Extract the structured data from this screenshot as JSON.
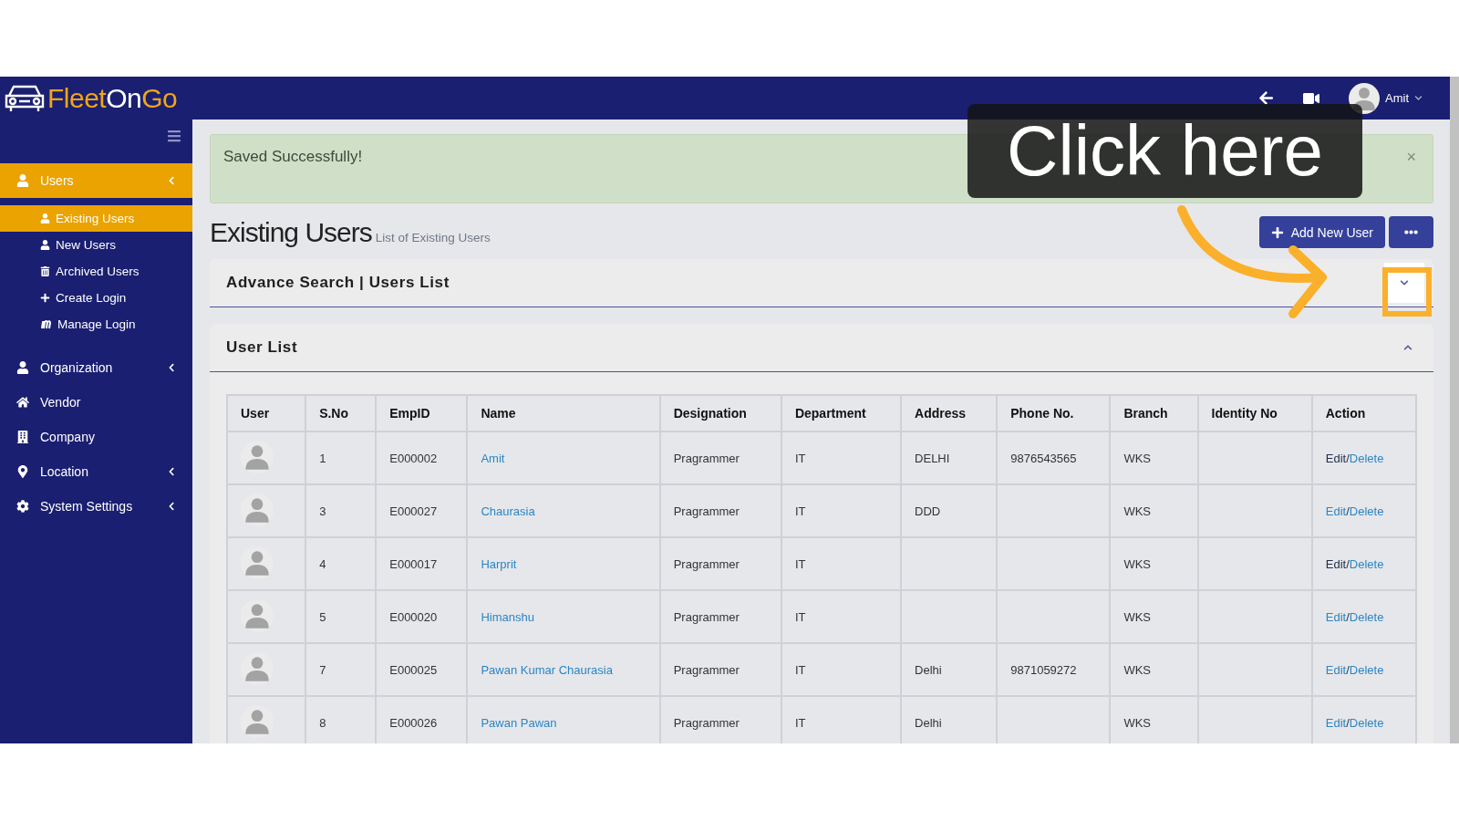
{
  "header": {
    "logo": [
      {
        "text": "Fleet",
        "color": "#f2a516"
      },
      {
        "text": "On",
        "color": "#ffffff"
      },
      {
        "text": "Go",
        "color": "#f2a516"
      }
    ],
    "user": "Amit"
  },
  "sidebar": {
    "items": [
      {
        "label": "Users",
        "kind": "group",
        "selected": true,
        "children": [
          {
            "label": "Existing Users",
            "selected": true
          },
          {
            "label": "New Users",
            "selected": false
          },
          {
            "label": "Archived Users",
            "selected": false
          },
          {
            "label": "Create Login",
            "selected": false
          },
          {
            "label": "Manage Login",
            "selected": false
          }
        ]
      },
      {
        "label": "Organization",
        "kind": "group",
        "selected": false
      },
      {
        "label": "Vendor",
        "kind": "link",
        "selected": false
      },
      {
        "label": "Company",
        "kind": "link",
        "selected": false
      },
      {
        "label": "Location",
        "kind": "group",
        "selected": false
      },
      {
        "label": "System Settings",
        "kind": "group",
        "selected": false
      }
    ]
  },
  "alert": {
    "message": "Saved Successfully!",
    "close": "×"
  },
  "page": {
    "title": "Existing Users",
    "subtitle": "List of Existing Users",
    "add_button": "Add New User"
  },
  "search_panel": {
    "title": "Advance Search | Users List",
    "expanded": false
  },
  "list_panel": {
    "title": "User List",
    "expanded": true
  },
  "table": {
    "columns": [
      "User",
      "S.No",
      "EmpID",
      "Name",
      "Designation",
      "Department",
      "Address",
      "Phone No.",
      "Branch",
      "Identity No",
      "Action"
    ],
    "rows": [
      {
        "sno": "1",
        "emp_id": "E000002",
        "name": "Amit",
        "designation": "Pragrammer",
        "department": "IT",
        "address": "DELHI",
        "phone": "9876543565",
        "branch": "WKS",
        "edit": "Edit",
        "edit_visited": true,
        "separator": "/",
        "delete": "Delete"
      },
      {
        "sno": "3",
        "emp_id": "E000027",
        "name": "Chaurasia",
        "designation": "Pragrammer",
        "department": "IT",
        "address": "DDD",
        "branch": "WKS",
        "edit": "Edit",
        "edit_visited": false,
        "separator": "/",
        "delete": "Delete"
      },
      {
        "sno": "4",
        "emp_id": "E000017",
        "name": "Harprit",
        "designation": "Pragrammer",
        "department": "IT",
        "branch": "WKS",
        "edit": "Edit",
        "edit_visited": true,
        "separator": "/",
        "delete": "Delete"
      },
      {
        "sno": "5",
        "emp_id": "E000020",
        "name": "Himanshu",
        "designation": "Pragrammer",
        "department": "IT",
        "branch": "WKS",
        "edit": "Edit",
        "edit_visited": false,
        "separator": "/",
        "delete": "Delete"
      },
      {
        "sno": "7",
        "emp_id": "E000025",
        "name": "Pawan Kumar Chaurasia",
        "designation": "Pragrammer",
        "department": "IT",
        "address": "Delhi",
        "phone": "9871059272",
        "branch": "WKS",
        "edit": "Edit",
        "edit_visited": false,
        "separator": "/",
        "delete": "Delete"
      },
      {
        "sno": "8",
        "emp_id": "E000026",
        "name": "Pawan Pawan",
        "designation": "Pragrammer",
        "department": "IT",
        "address": "Delhi",
        "branch": "WKS",
        "edit": "Edit",
        "edit_visited": false,
        "separator": "/",
        "delete": "Delete"
      }
    ]
  },
  "annotation": {
    "callout": "Click here"
  }
}
